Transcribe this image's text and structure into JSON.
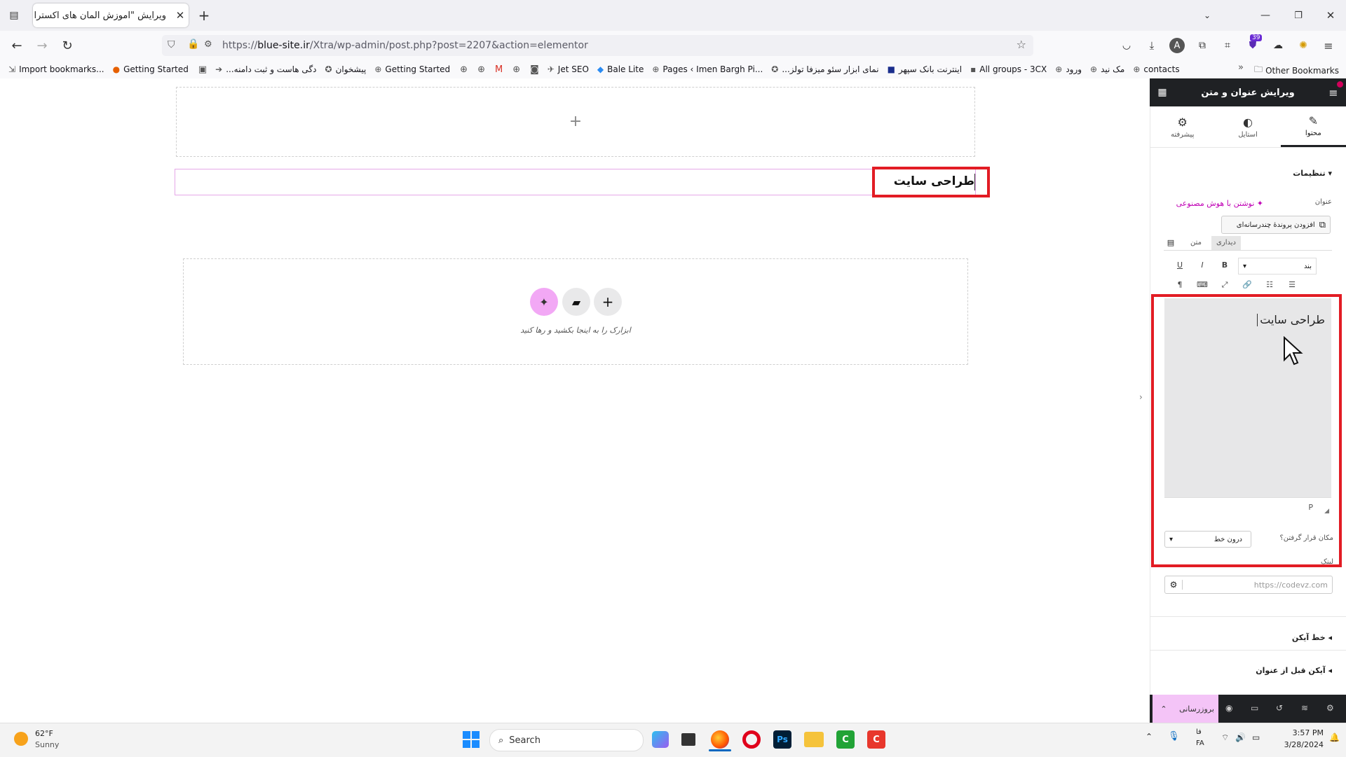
{
  "browser": {
    "tab_title": "ویرایش \"آموزش المان های اکسترا – ه",
    "url_prefix": "https://",
    "url_domain": "blue-site.ir",
    "url_path": "/Xtra/wp-admin/post.php?post=2207&action=elementor",
    "extension_badge": "39",
    "bookmarks": [
      "Import bookmarks...",
      "Getting Started",
      "...دگی هاست و ثبت دامنه",
      "پیشخوان",
      "Getting Started",
      "Jet SEO",
      "Bale Lite",
      "Pages ‹ Imen Bargh Pi...",
      "...نمای ابزار سئو میزفا تولز",
      "اینترنت بانک سپهر",
      "All groups - 3CX",
      "ورود",
      "مک نید",
      "contacts"
    ],
    "other_bookmarks": "Other Bookmarks"
  },
  "canvas": {
    "heading_text": "طراحی سایت",
    "dropzone_hint": "ابزارک را به اینجا بکشید و رها کنید"
  },
  "panel": {
    "title": "ویرایش عنوان و متن",
    "tabs": [
      {
        "label": "محتوا",
        "icon": "pencil-icon"
      },
      {
        "label": "استایل",
        "icon": "contrast-icon"
      },
      {
        "label": "پیشرفته",
        "icon": "gear-icon"
      }
    ],
    "section_settings": "تنظیمات",
    "title_label": "عنوان",
    "ai_write": "نوشتن با هوش مصنوعی",
    "add_media": "افزودن پروندهٔ چندرسانه‌ای",
    "editor_tab_visual": "دیداری",
    "editor_tab_text": "متن",
    "format_select": "بند",
    "editor_content": "طراحی سایت",
    "editor_path": "P",
    "position_label": "مکان قرار گرفتن؟",
    "position_value": "درون خط",
    "link_label": "لینک",
    "link_placeholder": "https://codevz.com",
    "section_icon_line": "خط آیکن",
    "section_icon_before": "آیکن قبل از عنوان",
    "update_button": "بروزرسانی"
  },
  "taskbar": {
    "weather_temp": "62°F",
    "weather_desc": "Sunny",
    "search_placeholder": "Search",
    "lang_top": "فا",
    "lang_bottom": "FA",
    "time": "3:57 PM",
    "date": "3/28/2024"
  }
}
